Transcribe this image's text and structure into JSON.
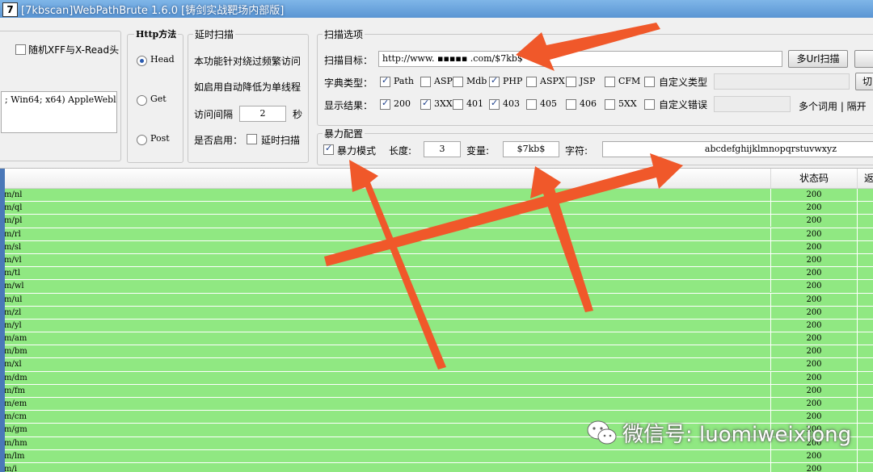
{
  "window": {
    "app_icon": "7",
    "title": "[7kbscan]WebPathBrute 1.6.0 [铸剑实战靶场内部版]"
  },
  "left_panel": {
    "random_xff_label": "随机XFF与X-Read头",
    "random_xff_checked": false,
    "ua_text": "; Win64; x64) AppleWebl"
  },
  "http_method": {
    "title": "Http方法",
    "options": [
      {
        "label": "Head",
        "selected": true
      },
      {
        "label": "Get",
        "selected": false
      },
      {
        "label": "Post",
        "selected": false
      }
    ]
  },
  "delay_scan": {
    "title": "延时扫描",
    "desc_line1": "本功能针对绕过频繁访问",
    "desc_line2": "如启用自动降低为单线程",
    "interval_label": "访问间隔",
    "interval_value": "2",
    "interval_unit": "秒",
    "enable_label": "是否启用：",
    "enable_checkbox_label": "延时扫描",
    "enabled": false
  },
  "scan_options": {
    "title": "扫描选项",
    "target_label": "扫描目标：",
    "target_value": "http://www.    ▪▪▪▪▪ .com/$7kb$",
    "multi_url_button": "多Url扫描",
    "dict_type_label": "字典类型：",
    "dict_types": [
      {
        "label": "Path",
        "checked": true
      },
      {
        "label": "ASP",
        "checked": false
      },
      {
        "label": "Mdb",
        "checked": false
      },
      {
        "label": "PHP",
        "checked": true
      },
      {
        "label": "ASPX",
        "checked": false
      },
      {
        "label": "JSP",
        "checked": false
      },
      {
        "label": "CFM",
        "checked": false
      }
    ],
    "custom_type_label": "自定义类型",
    "custom_type_checked": false,
    "switch_button": "切",
    "show_results_label": "显示结果：",
    "show_results": [
      {
        "label": "200",
        "checked": true
      },
      {
        "label": "3XX",
        "checked": true
      },
      {
        "label": "401",
        "checked": false
      },
      {
        "label": "403",
        "checked": true
      },
      {
        "label": "405",
        "checked": false
      },
      {
        "label": "406",
        "checked": false
      },
      {
        "label": "5XX",
        "checked": false
      }
    ],
    "custom_error_label": "自定义错误",
    "custom_error_checked": false,
    "multi_word_hint": "多个词用 | 隔开"
  },
  "brute_config": {
    "title": "暴力配置",
    "mode_label": "暴力模式",
    "mode_checked": true,
    "length_label": "长度:",
    "length_value": "3",
    "variable_label": "变量:",
    "variable_value": "$7kb$",
    "charset_label": "字符:",
    "charset_value": "abcdefghijklmnopqrstuvwxyz"
  },
  "results_table": {
    "columns": [
      "状态码",
      "返"
    ],
    "rows": [
      {
        "path": "m/nl",
        "code": "200"
      },
      {
        "path": "m/ql",
        "code": "200"
      },
      {
        "path": "m/pl",
        "code": "200"
      },
      {
        "path": "m/rl",
        "code": "200"
      },
      {
        "path": "m/sl",
        "code": "200"
      },
      {
        "path": "m/vl",
        "code": "200"
      },
      {
        "path": "m/tl",
        "code": "200"
      },
      {
        "path": "m/wl",
        "code": "200"
      },
      {
        "path": "m/ul",
        "code": "200"
      },
      {
        "path": "m/zl",
        "code": "200"
      },
      {
        "path": "m/yl",
        "code": "200"
      },
      {
        "path": "m/am",
        "code": "200"
      },
      {
        "path": "m/bm",
        "code": "200"
      },
      {
        "path": "m/xl",
        "code": "200"
      },
      {
        "path": "m/dm",
        "code": "200"
      },
      {
        "path": "m/fm",
        "code": "200"
      },
      {
        "path": "m/em",
        "code": "200"
      },
      {
        "path": "m/cm",
        "code": "200"
      },
      {
        "path": "m/gm",
        "code": "200"
      },
      {
        "path": "m/hm",
        "code": "200"
      },
      {
        "path": "m/lm",
        "code": "200"
      },
      {
        "path": "m/i",
        "code": "200"
      }
    ]
  },
  "watermark": {
    "text": "微信号: luomiweixiong"
  },
  "colors": {
    "row_green": "#90e882",
    "arrow_red": "#f0582a",
    "title_blue": "#5a95d3"
  }
}
